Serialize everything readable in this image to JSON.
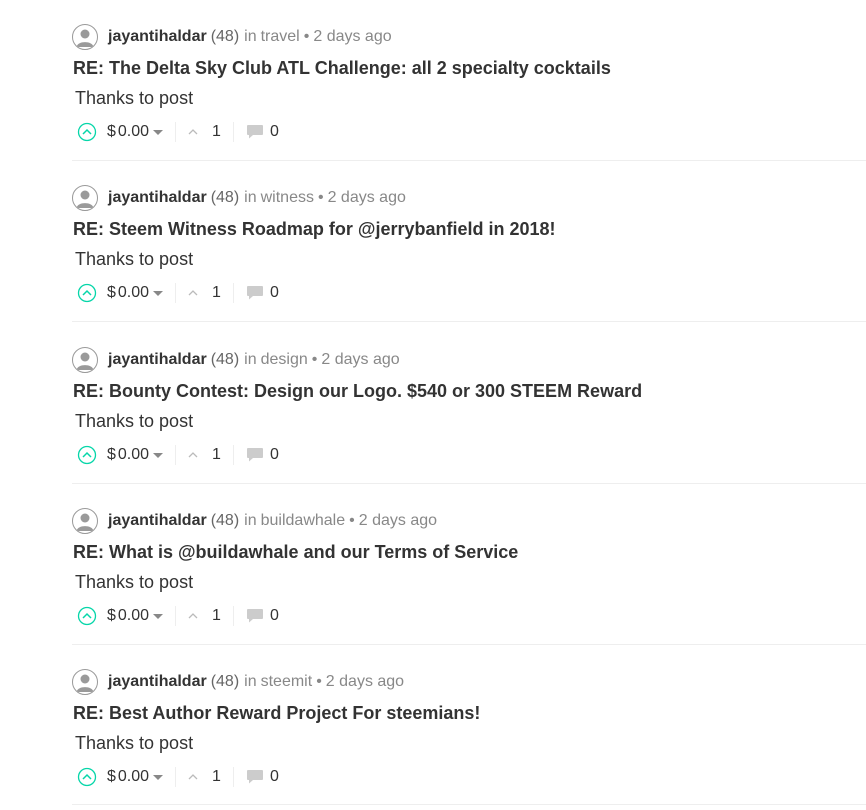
{
  "colors": {
    "upvote_accent": "#06d6a9",
    "text_primary": "#333333",
    "text_muted": "#888888",
    "divider": "#eeeeee"
  },
  "icons": {
    "avatar": "user-avatar-icon",
    "upvote": "upvote-circle-icon",
    "payout_dropdown": "caret-down-icon",
    "votes": "chevron-up-icon",
    "replies": "comment-bubble-icon"
  },
  "posts": [
    {
      "author": "jayantihaldar",
      "reputation": "(48)",
      "in_label": "in",
      "category": "travel",
      "separator": "•",
      "time": "2 days ago",
      "title": "RE: The Delta Sky Club ATL Challenge: all 2 specialty cocktails",
      "body": "Thanks to post",
      "payout_currency": "$",
      "payout": "0.00",
      "votes": "1",
      "replies": "0"
    },
    {
      "author": "jayantihaldar",
      "reputation": "(48)",
      "in_label": "in",
      "category": "witness",
      "separator": "•",
      "time": "2 days ago",
      "title": "RE: Steem Witness Roadmap for @jerrybanfield in 2018!",
      "body": "Thanks to post",
      "payout_currency": "$",
      "payout": "0.00",
      "votes": "1",
      "replies": "0"
    },
    {
      "author": "jayantihaldar",
      "reputation": "(48)",
      "in_label": "in",
      "category": "design",
      "separator": "•",
      "time": "2 days ago",
      "title": "RE: Bounty Contest: Design our Logo. $540 or 300 STEEM Reward",
      "body": "Thanks to post",
      "payout_currency": "$",
      "payout": "0.00",
      "votes": "1",
      "replies": "0"
    },
    {
      "author": "jayantihaldar",
      "reputation": "(48)",
      "in_label": "in",
      "category": "buildawhale",
      "separator": "•",
      "time": "2 days ago",
      "title": "RE: What is @buildawhale and our Terms of Service",
      "body": "Thanks to post",
      "payout_currency": "$",
      "payout": "0.00",
      "votes": "1",
      "replies": "0"
    },
    {
      "author": "jayantihaldar",
      "reputation": "(48)",
      "in_label": "in",
      "category": "steemit",
      "separator": "•",
      "time": "2 days ago",
      "title": "RE: Best Author Reward Project For steemians!",
      "body": "Thanks to post",
      "payout_currency": "$",
      "payout": "0.00",
      "votes": "1",
      "replies": "0"
    }
  ]
}
